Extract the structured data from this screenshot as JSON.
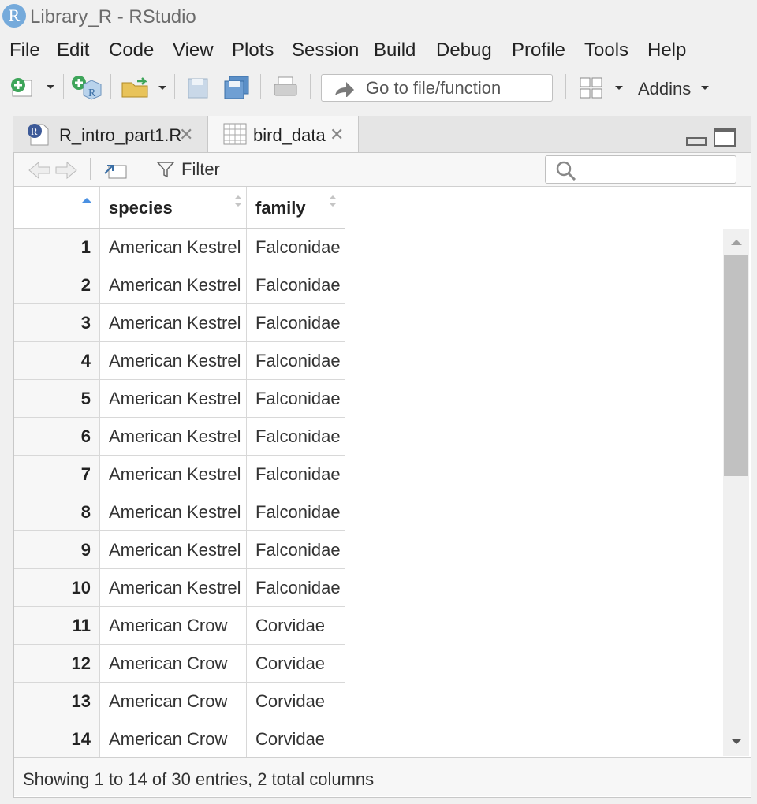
{
  "window": {
    "title": "Library_R - RStudio",
    "logo_letter": "R"
  },
  "menu": [
    "File",
    "Edit",
    "Code",
    "View",
    "Plots",
    "Session",
    "Build",
    "Debug",
    "Profile",
    "Tools",
    "Help"
  ],
  "toolbar": {
    "goto_placeholder": "Go to file/function",
    "addins_label": "Addins"
  },
  "tabs": [
    {
      "label": "R_intro_part1.R",
      "icon": "r-file-icon",
      "active": false
    },
    {
      "label": "bird_data",
      "icon": "table-icon",
      "active": true
    }
  ],
  "viewer": {
    "filter_label": "Filter",
    "search_value": ""
  },
  "table": {
    "columns": [
      "species",
      "family"
    ],
    "rows": [
      {
        "n": "1",
        "species": "American Kestrel",
        "family": "Falconidae"
      },
      {
        "n": "2",
        "species": "American Kestrel",
        "family": "Falconidae"
      },
      {
        "n": "3",
        "species": "American Kestrel",
        "family": "Falconidae"
      },
      {
        "n": "4",
        "species": "American Kestrel",
        "family": "Falconidae"
      },
      {
        "n": "5",
        "species": "American Kestrel",
        "family": "Falconidae"
      },
      {
        "n": "6",
        "species": "American Kestrel",
        "family": "Falconidae"
      },
      {
        "n": "7",
        "species": "American Kestrel",
        "family": "Falconidae"
      },
      {
        "n": "8",
        "species": "American Kestrel",
        "family": "Falconidae"
      },
      {
        "n": "9",
        "species": "American Kestrel",
        "family": "Falconidae"
      },
      {
        "n": "10",
        "species": "American Kestrel",
        "family": "Falconidae"
      },
      {
        "n": "11",
        "species": "American Crow",
        "family": "Corvidae"
      },
      {
        "n": "12",
        "species": "American Crow",
        "family": "Corvidae"
      },
      {
        "n": "13",
        "species": "American Crow",
        "family": "Corvidae"
      },
      {
        "n": "14",
        "species": "American Crow",
        "family": "Corvidae"
      }
    ]
  },
  "footer": {
    "status": "Showing 1 to 14 of 30 entries, 2 total columns"
  },
  "colors": {
    "accent": "#75aadb",
    "sort_indicator": "#4a90e2"
  }
}
